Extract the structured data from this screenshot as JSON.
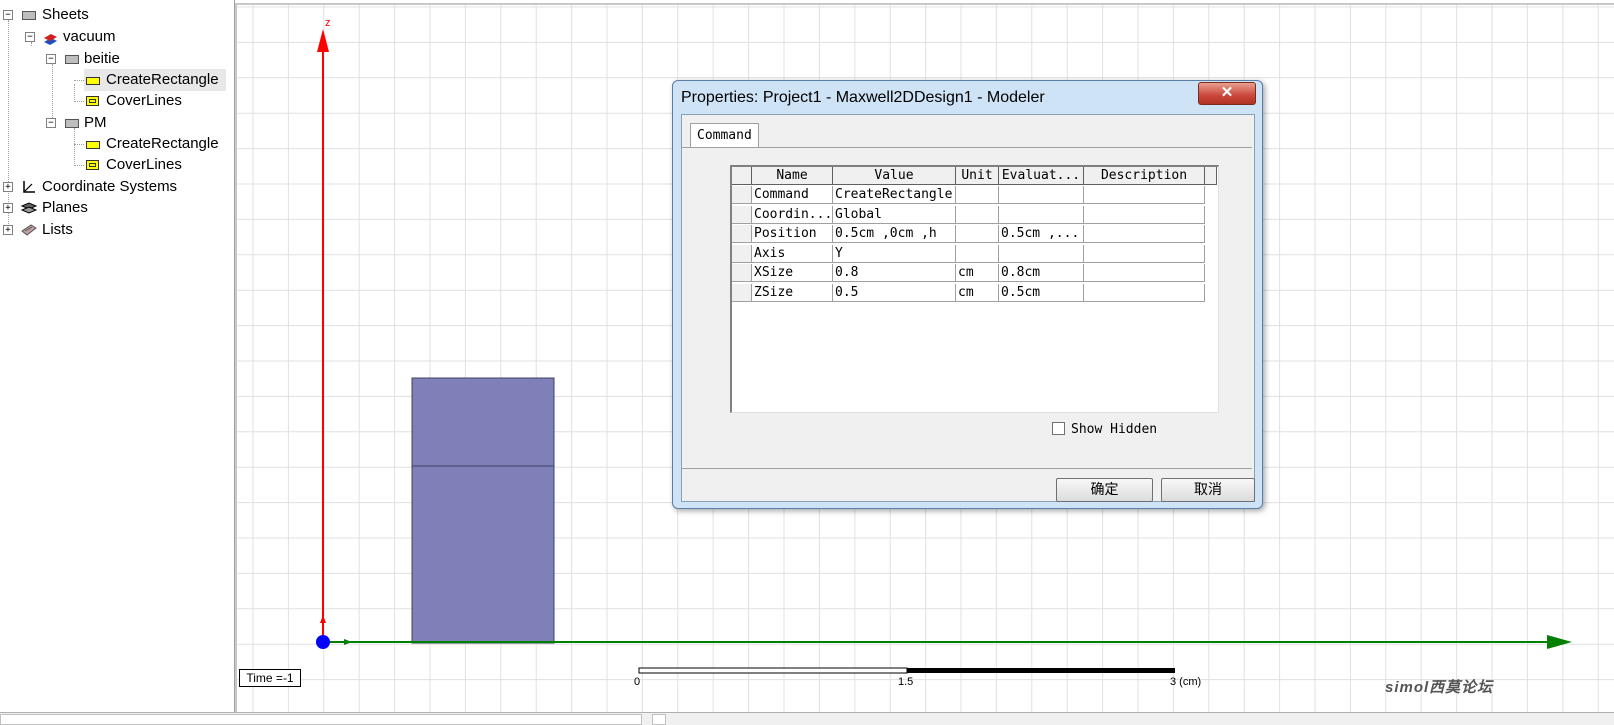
{
  "tree": {
    "root": "Sheets",
    "material": "vacuum",
    "objects": [
      {
        "name": "beitie",
        "children": [
          "CreateRectangle",
          "CoverLines"
        ]
      },
      {
        "name": "PM",
        "children": [
          "CreateRectangle",
          "CoverLines"
        ]
      }
    ],
    "others": [
      "Coordinate Systems",
      "Planes",
      "Lists"
    ]
  },
  "viewport": {
    "axis_label": "z",
    "time_label": "Time =-1",
    "scale": {
      "min": "0",
      "mid": "1.5",
      "max": "3 (cm)"
    },
    "colors": {
      "z_axis": "#ff0000",
      "x_axis": "#008000",
      "origin": "#0000ff",
      "rect": "#8080b8",
      "grid": "#e0e0e0"
    }
  },
  "dialog": {
    "title": "Properties: Project1 - Maxwell2DDesign1 - Modeler",
    "close_label": "✕",
    "tab": "Command",
    "columns": [
      "Name",
      "Value",
      "Unit",
      "Evaluat...",
      "Description"
    ],
    "rows": [
      [
        "Command",
        "CreateRectangle",
        "",
        "",
        ""
      ],
      [
        "Coordin...",
        "Global",
        "",
        "",
        ""
      ],
      [
        "Position",
        "0.5cm ,0cm ,h",
        "",
        "0.5cm ,...",
        ""
      ],
      [
        "Axis",
        "Y",
        "",
        "",
        ""
      ],
      [
        "XSize",
        "0.8",
        "cm",
        "0.8cm",
        ""
      ],
      [
        "ZSize",
        "0.5",
        "cm",
        "0.5cm",
        ""
      ]
    ],
    "show_hidden_label": "Show Hidden",
    "ok_label": "确定",
    "cancel_label": "取消"
  },
  "watermark": "simol西莫论坛"
}
